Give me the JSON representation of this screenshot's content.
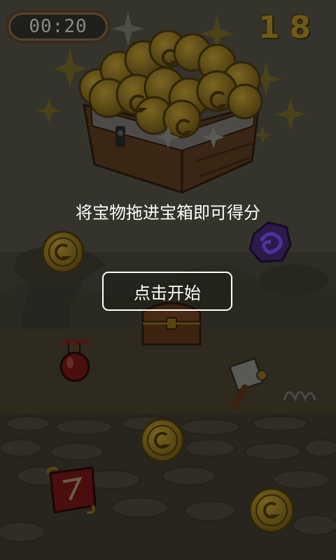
{
  "hud": {
    "timer": "00:20",
    "score": "18"
  },
  "instruction": "将宝物拖进宝箱即可得分",
  "start_button": "点击开始",
  "icons": {
    "chest": "treasure-chest-icon",
    "coin": "gold-coin-icon",
    "gem": "purple-gem-icon",
    "potion": "red-potion-icon",
    "hammer": "hammer-icon",
    "scroll": "red-scroll-icon",
    "small_chest": "small-chest-icon"
  }
}
